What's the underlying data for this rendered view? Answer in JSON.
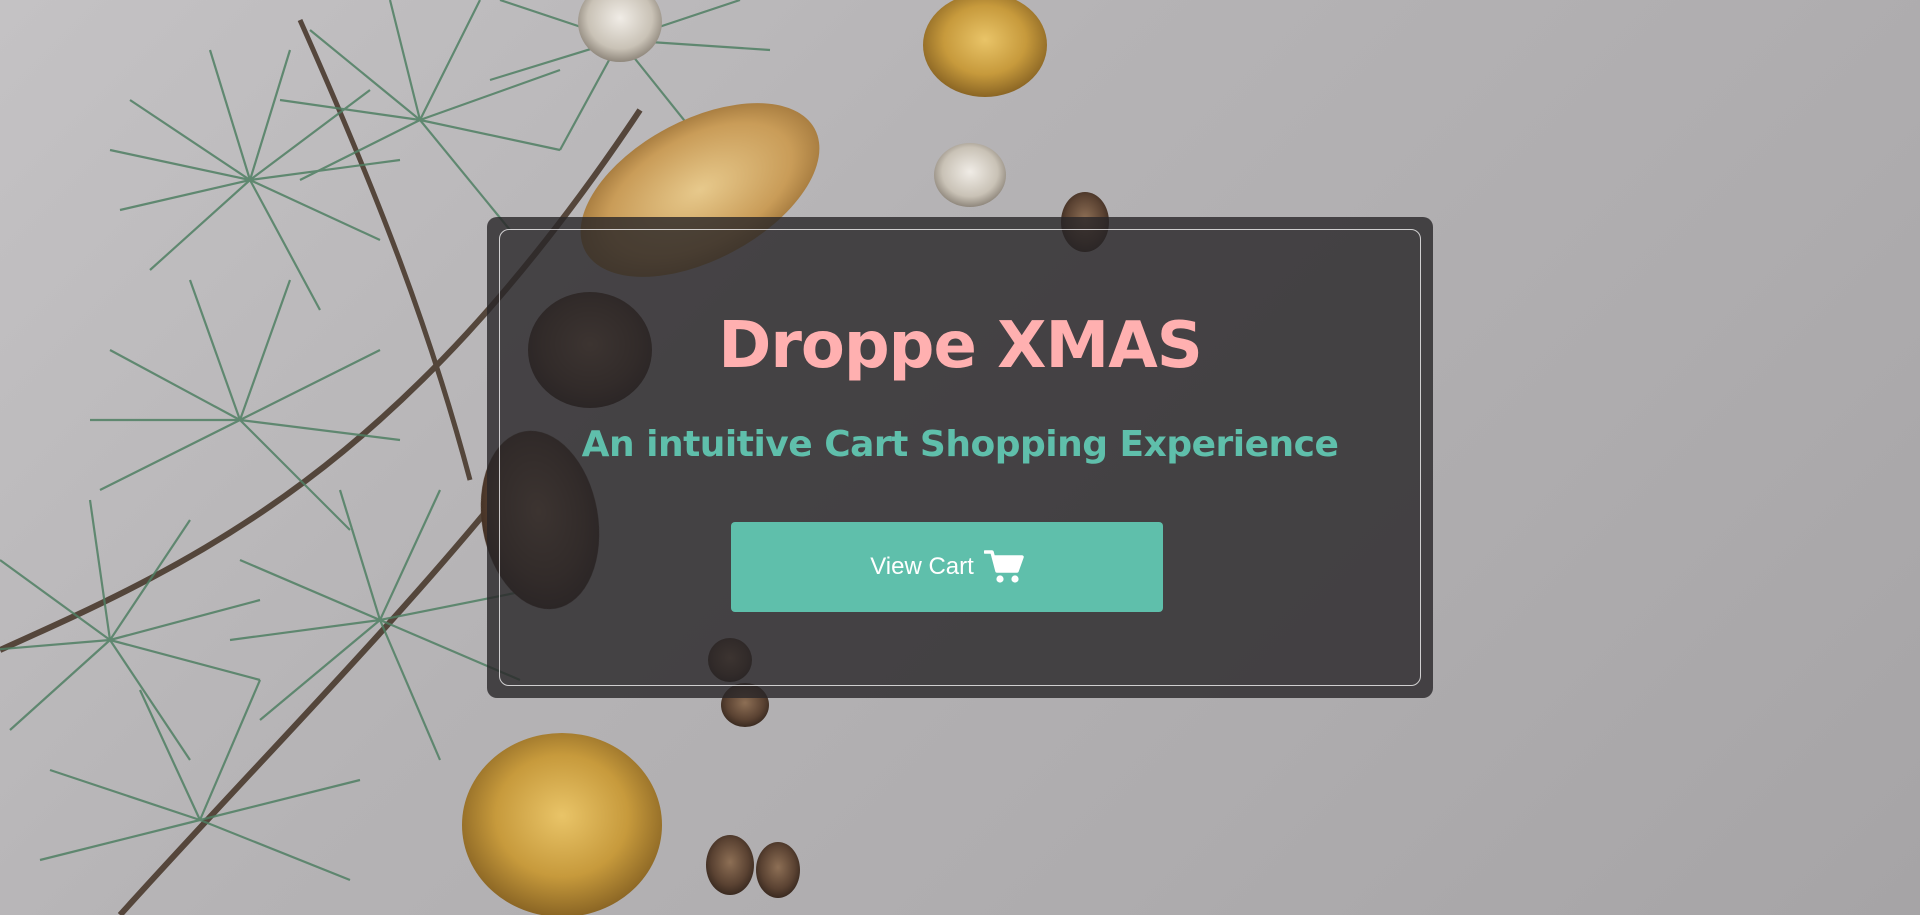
{
  "hero": {
    "title": "Droppe XMAS",
    "subtitle": "An intuitive Cart Shopping Experience",
    "cta_label": "View Cart",
    "cta_icon": "shopping-cart-icon"
  },
  "colors": {
    "title": "#ffb0b0",
    "subtitle": "#5fbfab",
    "button_bg": "#5fbfab",
    "button_text": "#ffffff",
    "overlay": "#282628",
    "background": "#b5b3b5"
  }
}
